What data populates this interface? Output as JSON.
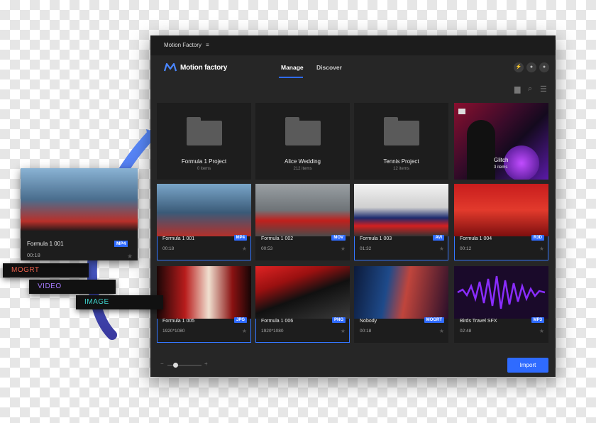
{
  "window": {
    "app_title": "Motion Factory",
    "menu_icon": "hamburger-icon",
    "brand": "Motion factory",
    "tabs": [
      {
        "label": "Manage",
        "active": true
      },
      {
        "label": "Discover",
        "active": false
      }
    ],
    "header_icons": [
      "flash-icon",
      "bell-icon",
      "user-icon"
    ],
    "toolbar_icons": [
      "add-folder-icon",
      "search-icon",
      "sort-icon"
    ],
    "import_label": "Import",
    "accent": "#2f6bff"
  },
  "folders": [
    {
      "title": "Formula 1 Project",
      "count": "0 items"
    },
    {
      "title": "Alice Wedding",
      "count": "212  items"
    },
    {
      "title": "Tennis Project",
      "count": "12 items"
    },
    {
      "title": "Glitch",
      "count": "3 items"
    }
  ],
  "assets": [
    {
      "name": "Formula 1 001",
      "meta": "00:18",
      "format": "MP4",
      "selected": true
    },
    {
      "name": "Formula 1 002",
      "meta": "00:53",
      "format": "MOV",
      "selected": false
    },
    {
      "name": "Formula 1 003",
      "meta": "01:32",
      "format": "AVI",
      "selected": true
    },
    {
      "name": "Formula 1 004",
      "meta": "00:12",
      "format": "R3D",
      "selected": true
    },
    {
      "name": "Formula 1 005",
      "meta": "1920*1080",
      "format": "JPG",
      "selected": true
    },
    {
      "name": "Formula 1 006",
      "meta": "1920*1080",
      "format": "PNG",
      "selected": true
    },
    {
      "name": "Nobody",
      "meta": "00:18",
      "format": "MOGRT",
      "selected": false
    },
    {
      "name": "Birds Travel SFX",
      "meta": "02:48",
      "format": "MP3",
      "selected": false
    }
  ],
  "overlay": {
    "card": {
      "name": "Formula 1 001",
      "time": "00:18",
      "format": "MP4"
    },
    "type_labels": [
      {
        "label": "MOGRT",
        "color": "#f0624d"
      },
      {
        "label": "VIDEO",
        "color": "#a77cff"
      },
      {
        "label": "IMAGE",
        "color": "#3fd6d0"
      }
    ]
  }
}
